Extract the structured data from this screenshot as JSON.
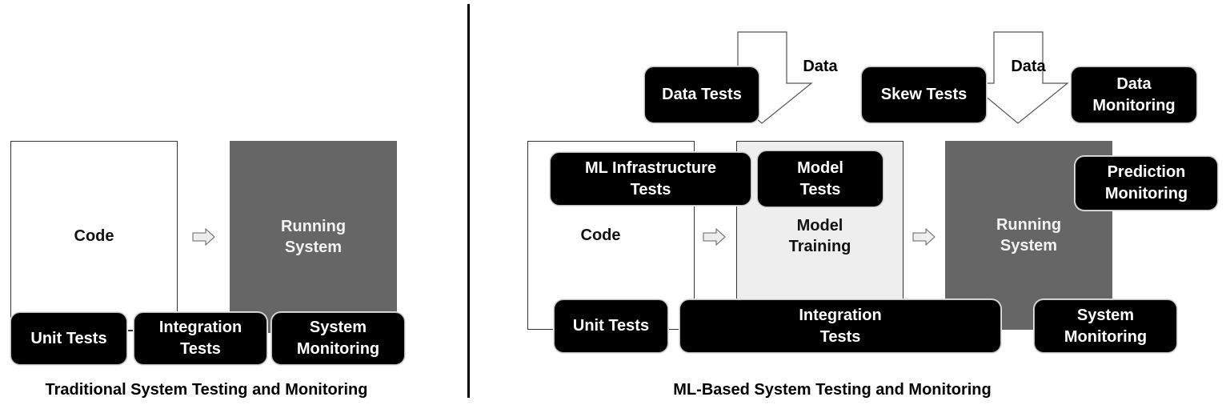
{
  "traditional": {
    "caption": "Traditional System Testing and Monitoring",
    "code_label": "Code",
    "running_system_label": "Running\nSystem",
    "tests": {
      "unit": "Unit Tests",
      "integration": "Integration\nTests",
      "system_monitoring": "System\nMonitoring"
    }
  },
  "ml": {
    "caption": "ML-Based System Testing and Monitoring",
    "code_label": "Code",
    "model_training_label": "Model\nTraining",
    "running_system_label": "Running\nSystem",
    "data_arrows": [
      "Data",
      "Data"
    ],
    "tests": {
      "data_tests": "Data Tests",
      "skew_tests": "Skew Tests",
      "data_monitoring": "Data\nMonitoring",
      "ml_infrastructure": "ML Infrastructure\nTests",
      "model_tests": "Model\nTests",
      "prediction_monitoring": "Prediction\nMonitoring",
      "unit": "Unit Tests",
      "integration": "Integration\nTests",
      "system_monitoring": "System\nMonitoring"
    }
  },
  "colors": {
    "test_fill": "#000000",
    "running_system_fill": "#666666",
    "model_training_fill": "#eeeeee",
    "code_fill": "#ffffff"
  }
}
